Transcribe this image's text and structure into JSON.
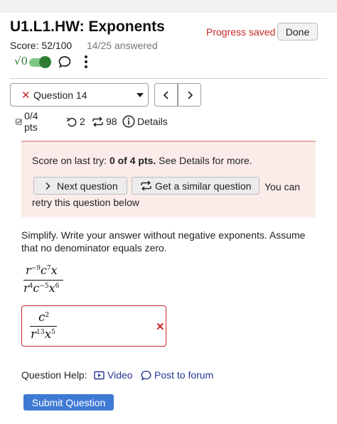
{
  "header": {
    "title": "U1.L1.HW: Exponents",
    "progress_status": "Progress saved",
    "done_label": "Done",
    "score": "Score: 52/100",
    "answered": "14/25 answered",
    "math_toggle_label": "√0",
    "math_toggle_on": true
  },
  "question_nav": {
    "selected_status_icon": "✕",
    "selected_question": "Question 14",
    "prev_icon": "chevron-left-icon",
    "next_icon": "chevron-right-icon"
  },
  "stats": {
    "points": "0/4 pts",
    "retries": "2",
    "attempts": "98",
    "details_label": "Details"
  },
  "alert": {
    "prefix": "Score on last try: ",
    "score_bold": "0 of 4 pts.",
    "suffix": " See Details for more.",
    "next_question_label": "Next question",
    "similar_question_label": "Get a similar question",
    "retry_text_1": "You can",
    "retry_text_2": "retry this question below"
  },
  "question": {
    "prompt": "Simplify. Write your answer without negative exponents. Assume that no denominator equals zero.",
    "expression": {
      "num": [
        {
          "base": "r",
          "exp": "−9"
        },
        {
          "base": "c",
          "exp": "7"
        },
        {
          "base": "x",
          "exp": ""
        }
      ],
      "den": [
        {
          "base": "r",
          "exp": "4"
        },
        {
          "base": "c",
          "exp": "−5"
        },
        {
          "base": "x",
          "exp": "6"
        }
      ]
    },
    "answer": {
      "num": [
        {
          "base": "c",
          "exp": "2"
        }
      ],
      "den": [
        {
          "base": "r",
          "exp": "13"
        },
        {
          "base": "x",
          "exp": "5"
        }
      ],
      "status_icon": "✕"
    }
  },
  "help": {
    "label": "Question Help:",
    "video_label": "Video",
    "forum_label": "Post to forum"
  },
  "submit_label": "Submit Question",
  "colors": {
    "error_red": "#c62828",
    "alert_bg": "#fbecea",
    "link_blue": "#283593",
    "submit_blue": "#3f7ad4",
    "toggle_green": "#2e7d32"
  }
}
